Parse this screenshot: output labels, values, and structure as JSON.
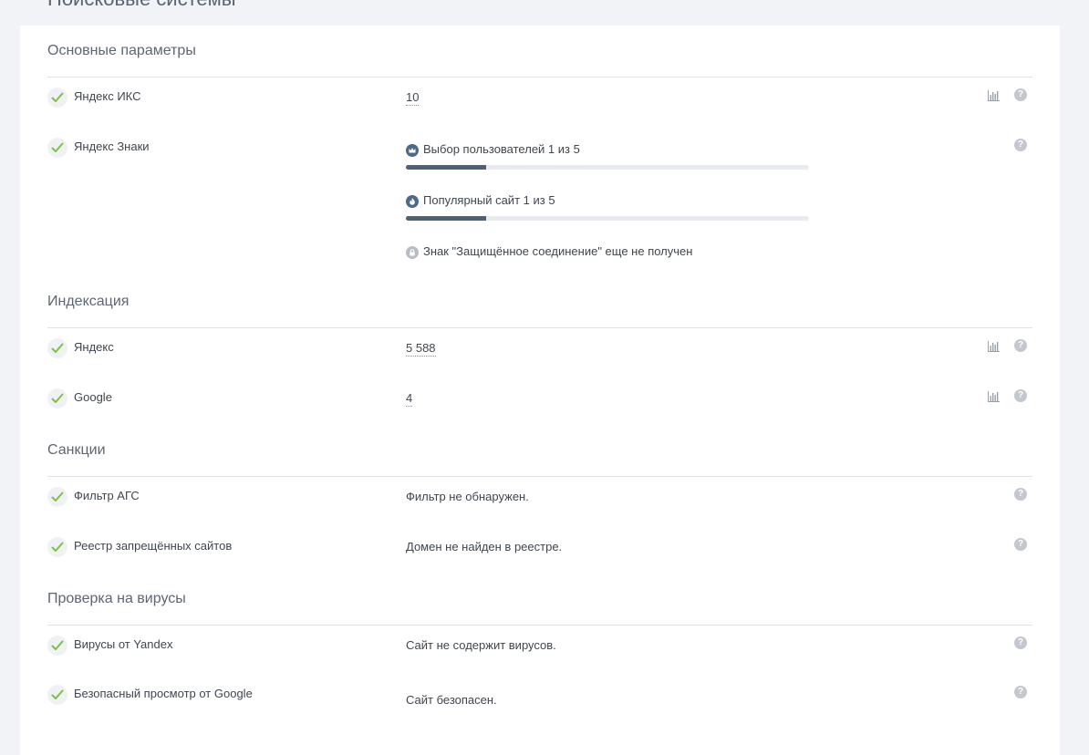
{
  "page": {
    "heading": "Поисковые системы"
  },
  "sections": {
    "main": {
      "title": "Основные параметры",
      "iks": {
        "label": "Яндекс ИКС",
        "value": "10"
      },
      "signs": {
        "label": "Яндекс Знаки",
        "users_choice": {
          "text": "Выбор пользователей 1 из 5",
          "progress": 0.2,
          "icon": "crown-icon"
        },
        "popular": {
          "text": "Популярный сайт 1 из 5",
          "progress": 0.2,
          "icon": "flame-icon"
        },
        "secure": {
          "text": "Знак \"Защищённое соединение\" еще не получен",
          "icon": "lock-icon"
        }
      }
    },
    "indexing": {
      "title": "Индексация",
      "yandex": {
        "label": "Яндекс",
        "value": "5 588"
      },
      "google": {
        "label": "Google",
        "value": "4"
      }
    },
    "sanctions": {
      "title": "Санкции",
      "ags": {
        "label": "Фильтр АГС",
        "value": "Фильтр не обнаружен."
      },
      "registry": {
        "label": "Реестр запрещённых сайтов",
        "value": "Домен не найден в реестре."
      }
    },
    "viruses": {
      "title": "Проверка на вирусы",
      "yandex": {
        "label": "Вирусы от Yandex",
        "value": "Сайт не содержит вирусов."
      },
      "google": {
        "label": "Безопасный просмотр от Google",
        "value": "Сайт безопасен."
      }
    }
  },
  "icons": {
    "help": "?"
  },
  "colors": {
    "check": "#7cc242",
    "accent": "#4d6279",
    "help": "#c3c8d0"
  }
}
